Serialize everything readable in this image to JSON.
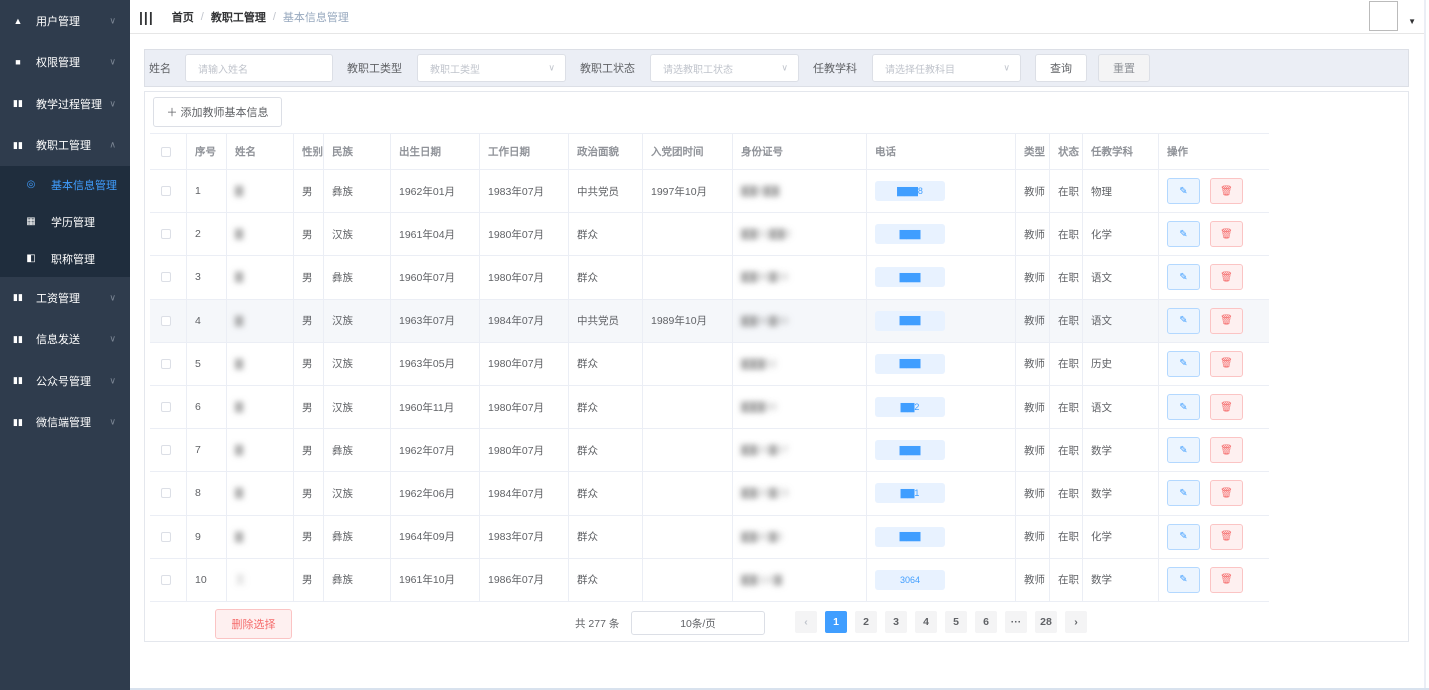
{
  "sidebar": {
    "menus": [
      {
        "label": "用户管理",
        "icon": "user-icon",
        "glyph": "▲",
        "chev": "∨"
      },
      {
        "label": "权限管理",
        "icon": "list-icon",
        "glyph": "■",
        "chev": "∨"
      },
      {
        "label": "教学过程管理",
        "icon": "chart-icon",
        "glyph": "▮▮",
        "chev": "∨"
      },
      {
        "label": "教职工管理",
        "icon": "chart-icon",
        "glyph": "▮▮",
        "chev": "∧"
      }
    ],
    "submenu": [
      {
        "label": "基本信息管理",
        "icon": "info-circle-icon",
        "glyph": "◎",
        "active": true
      },
      {
        "label": "学历管理",
        "icon": "grid-icon",
        "glyph": "▦",
        "active": false
      },
      {
        "label": "职称管理",
        "icon": "id-card-icon",
        "glyph": "◧",
        "active": false
      }
    ],
    "menus_after": [
      {
        "label": "工资管理",
        "icon": "chart-icon",
        "glyph": "▮▮",
        "chev": "∨"
      },
      {
        "label": "信息发送",
        "icon": "chart-icon",
        "glyph": "▮▮",
        "chev": "∨"
      },
      {
        "label": "公众号管理",
        "icon": "chart-icon",
        "glyph": "▮▮",
        "chev": "∨"
      },
      {
        "label": "微信端管理",
        "icon": "chart-icon",
        "glyph": "▮▮",
        "chev": "∨"
      }
    ]
  },
  "topbar": {
    "hamburger": "|||",
    "breadcrumb": [
      "首页",
      "教职工管理",
      "基本信息管理"
    ],
    "separator": "/"
  },
  "search": {
    "name_label": "姓名",
    "name_placeholder": "请输入姓名",
    "type_label": "教职工类型",
    "type_placeholder": "教职工类型",
    "status_label": "教职工状态",
    "status_placeholder": "请选教职工状态",
    "subject_label": "任教学科",
    "subject_placeholder": "请选择任教科目",
    "query_label": "查询",
    "reset_label": "重置"
  },
  "toolbar": {
    "add_label": "＋ 添加教师基本信息"
  },
  "table": {
    "headers": [
      "",
      "序号",
      "姓名",
      "性别",
      "民族",
      "出生日期",
      "工作日期",
      "政治面貌",
      "入党团时间",
      "身份证号",
      "电话",
      "类型",
      "状态",
      "任教学科",
      "操作"
    ],
    "rows": [
      {
        "no": "1",
        "name": "▇",
        "gender": "男",
        "nation": "彝族",
        "birth": "1962年01月",
        "work": "1983年07月",
        "political": "中共党员",
        "party": "1997年10月",
        "id": "▇▇8▇▇",
        "phone": "▇▇▇8",
        "type": "教师",
        "status": "在职",
        "subject": "物理"
      },
      {
        "no": "2",
        "name": "▇",
        "gender": "男",
        "nation": "汉族",
        "birth": "1961年04月",
        "work": "1980年07月",
        "political": "群众",
        "party": "",
        "id": "▇▇51▇▇0",
        "phone": "▇▇▇",
        "type": "教师",
        "status": "在职",
        "subject": "化学"
      },
      {
        "no": "3",
        "name": "▇",
        "gender": "男",
        "nation": "彝族",
        "birth": "1960年07月",
        "work": "1980年07月",
        "political": "群众",
        "party": "",
        "id": "▇▇96▇50",
        "phone": "▇▇▇",
        "type": "教师",
        "status": "在职",
        "subject": "语文"
      },
      {
        "no": "4",
        "name": "▇",
        "gender": "男",
        "nation": "汉族",
        "birth": "1963年07月",
        "work": "1984年07月",
        "political": "中共党员",
        "party": "1989年10月",
        "id": "▇▇96▇80",
        "phone": "▇▇▇",
        "type": "教师",
        "status": "在职",
        "subject": "语文"
      },
      {
        "no": "5",
        "name": "▇",
        "gender": "男",
        "nation": "汉族",
        "birth": "1963年05月",
        "work": "1980年07月",
        "political": "群众",
        "party": "",
        "id": "▇▇▇52",
        "phone": "▇▇▇",
        "type": "教师",
        "status": "在职",
        "subject": "历史"
      },
      {
        "no": "6",
        "name": "▇",
        "gender": "男",
        "nation": "汉族",
        "birth": "1960年11月",
        "work": "1980年07月",
        "political": "群众",
        "party": "",
        "id": "▇▇▇00",
        "phone": "▇▇2",
        "type": "教师",
        "status": "在职",
        "subject": "语文"
      },
      {
        "no": "7",
        "name": "▇",
        "gender": "男",
        "nation": "彝族",
        "birth": "1962年07月",
        "work": "1980年07月",
        "political": "群众",
        "party": "",
        "id": "▇▇20▇07",
        "phone": "▇▇▇",
        "type": "教师",
        "status": "在职",
        "subject": "数学"
      },
      {
        "no": "8",
        "name": "▇",
        "gender": "男",
        "nation": "汉族",
        "birth": "1962年06月",
        "work": "1984年07月",
        "political": "群众",
        "party": "",
        "id": "▇▇20▇23",
        "phone": "▇▇1",
        "type": "教师",
        "status": "在职",
        "subject": "数学"
      },
      {
        "no": "9",
        "name": "▇",
        "gender": "男",
        "nation": "彝族",
        "birth": "1964年09月",
        "work": "1983年07月",
        "political": "群众",
        "party": "",
        "id": "▇▇40▇0",
        "phone": "▇▇▇",
        "type": "教师",
        "status": "在职",
        "subject": "化学"
      },
      {
        "no": "10",
        "name": "王",
        "gender": "男",
        "nation": "彝族",
        "birth": "1961年10月",
        "work": "1986年07月",
        "political": "群众",
        "party": "",
        "id": "▇▇110▇",
        "phone": "3064",
        "type": "教师",
        "status": "在职",
        "subject": "数学"
      }
    ]
  },
  "footer": {
    "delete_selected": "删除选择",
    "total": "共 277 条",
    "page_size": "10条/页",
    "prev": "‹",
    "next": "›",
    "pages": [
      "1",
      "2",
      "3",
      "4",
      "5",
      "6",
      "···",
      "28"
    ],
    "active_page": "1"
  },
  "colors": {
    "sidebar_bg": "#2f3c4d",
    "submenu_bg": "#1f2d3d",
    "accent": "#409eff",
    "danger": "#f56c6c"
  }
}
